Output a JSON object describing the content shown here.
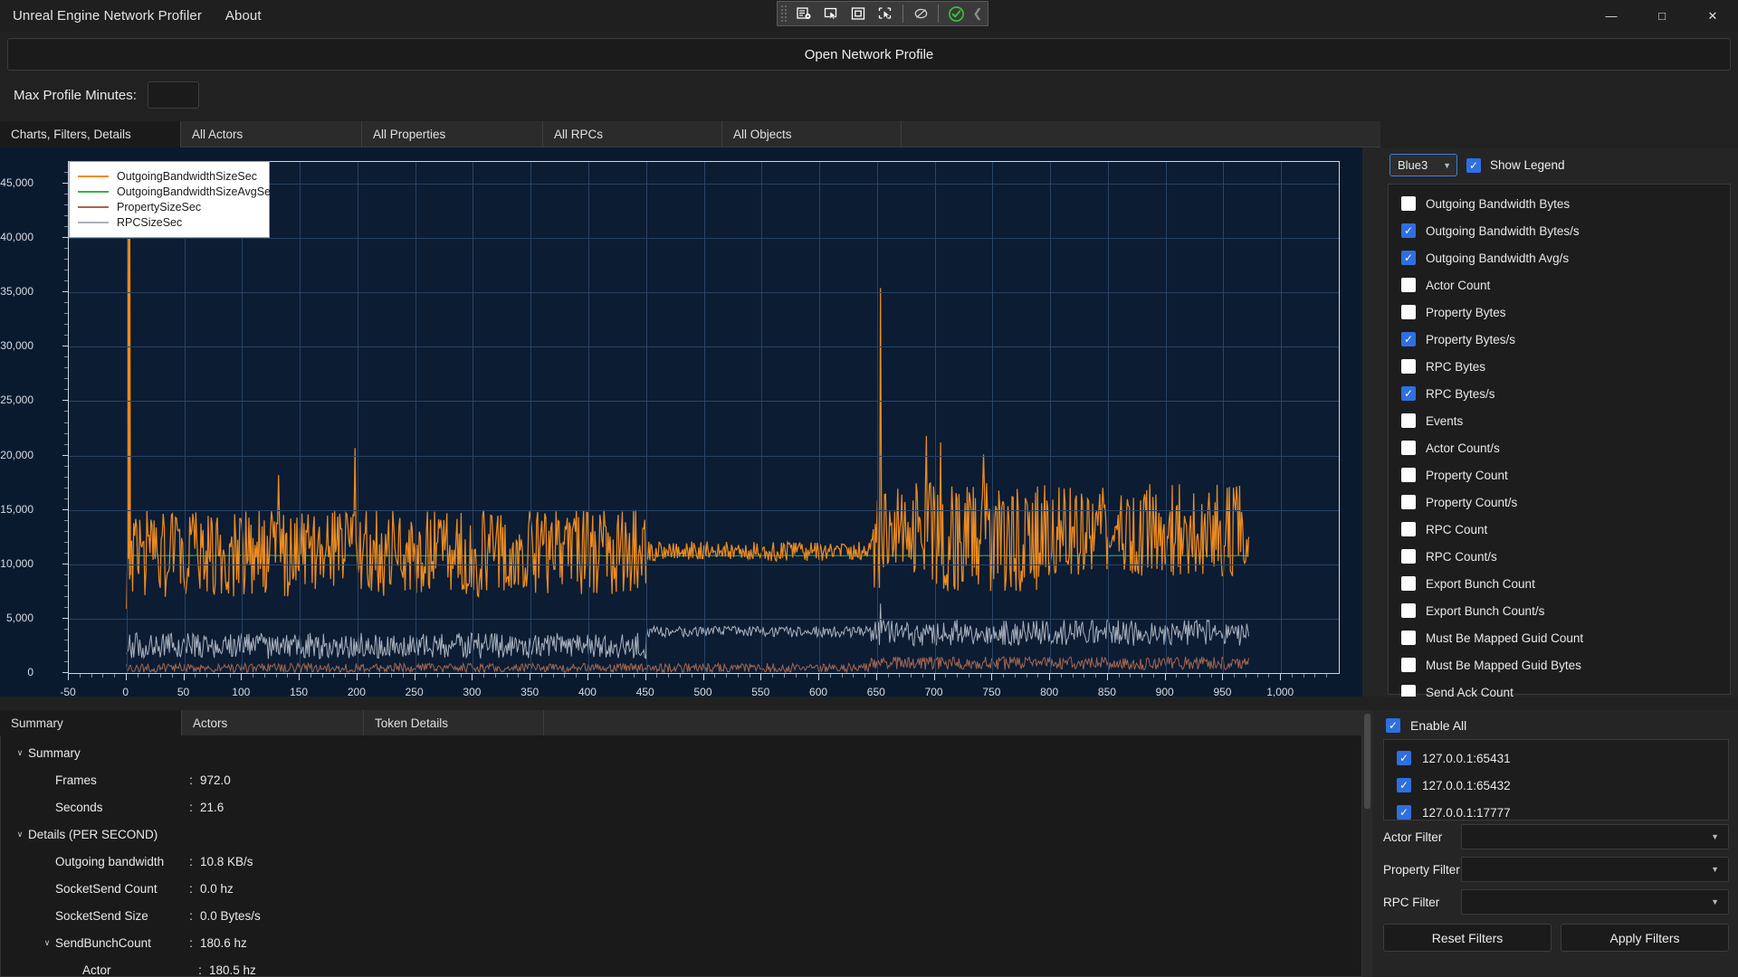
{
  "window": {
    "app_title": "Unreal Engine Network Profiler",
    "menu": [
      "Unreal Engine Network Profiler",
      "About"
    ],
    "controls": {
      "minimize": "—",
      "maximize": "□",
      "close": "✕"
    },
    "toolbar_icons": [
      "select-window-icon",
      "cursor-icon",
      "highlight-box-icon",
      "pick-element-icon",
      "disabled-icon",
      "check-circle-icon",
      "collapse-chevron-icon"
    ]
  },
  "open_profile": {
    "label": "Open Network Profile"
  },
  "max_profile": {
    "label": "Max Profile Minutes:",
    "value": "",
    "placeholder": ""
  },
  "top_tabs": [
    {
      "label": "Charts, Filters, Details",
      "active": true
    },
    {
      "label": "All Actors",
      "active": false
    },
    {
      "label": "All Properties",
      "active": false
    },
    {
      "label": "All RPCs",
      "active": false
    },
    {
      "label": "All Objects",
      "active": false
    }
  ],
  "chart_options": {
    "theme_value": "Blue3",
    "show_legend_label": "Show Legend",
    "show_legend_checked": true,
    "items": [
      {
        "label": "Outgoing Bandwidth Bytes",
        "checked": false
      },
      {
        "label": "Outgoing Bandwidth Bytes/s",
        "checked": true
      },
      {
        "label": "Outgoing Bandwidth Avg/s",
        "checked": true
      },
      {
        "label": "Actor Count",
        "checked": false
      },
      {
        "label": "Property Bytes",
        "checked": false
      },
      {
        "label": "Property Bytes/s",
        "checked": true
      },
      {
        "label": "RPC Bytes",
        "checked": false
      },
      {
        "label": "RPC Bytes/s",
        "checked": true
      },
      {
        "label": "Events",
        "checked": false
      },
      {
        "label": "Actor Count/s",
        "checked": false
      },
      {
        "label": "Property Count",
        "checked": false
      },
      {
        "label": "Property Count/s",
        "checked": false
      },
      {
        "label": "RPC Count",
        "checked": false
      },
      {
        "label": "RPC Count/s",
        "checked": false
      },
      {
        "label": "Export Bunch Count",
        "checked": false
      },
      {
        "label": "Export Bunch Count/s",
        "checked": false
      },
      {
        "label": "Must Be Mapped Guid Count",
        "checked": false
      },
      {
        "label": "Must Be Mapped Guid Bytes",
        "checked": false
      },
      {
        "label": "Send Ack Count",
        "checked": false
      }
    ]
  },
  "chart_data": {
    "type": "line",
    "title": "",
    "xlabel": "",
    "ylabel": "",
    "xlim": [
      -50,
      1050
    ],
    "ylim": [
      0,
      47000
    ],
    "xticks": [
      -50,
      0,
      50,
      100,
      150,
      200,
      250,
      300,
      350,
      400,
      450,
      500,
      550,
      600,
      650,
      700,
      750,
      800,
      850,
      900,
      950,
      1000
    ],
    "xticklabels": [
      "-50",
      "0",
      "50",
      "100",
      "150",
      "200",
      "250",
      "300",
      "350",
      "400",
      "450",
      "500",
      "550",
      "600",
      "650",
      "700",
      "750",
      "800",
      "850",
      "900",
      "950",
      "1,000"
    ],
    "yticks": [
      0,
      5000,
      10000,
      15000,
      20000,
      25000,
      30000,
      35000,
      40000,
      45000
    ],
    "yticklabels": [
      "0",
      "5,000",
      "10,000",
      "15,000",
      "20,000",
      "25,000",
      "30,000",
      "35,000",
      "40,000",
      "45,000"
    ],
    "grid": true,
    "legend_position": "top-left",
    "background": "#0b1c33",
    "series": [
      {
        "name": "OutgoingBandwidthSizeSec",
        "color": "#ED8B1F",
        "x_range": [
          0,
          972
        ],
        "baseline_mean": 11000,
        "noise_amplitude": 4200,
        "spikes": [
          {
            "x": 2,
            "y": 47000
          },
          {
            "x": 198,
            "y": 20700
          },
          {
            "x": 132,
            "y": 18200
          },
          {
            "x": 653,
            "y": 35400
          },
          {
            "x": 693,
            "y": 21800
          },
          {
            "x": 705,
            "y": 21200
          },
          {
            "x": 742,
            "y": 20100
          }
        ],
        "segment_notes": "dense ~7000-16000 band across full range; low-variance dip 455-640 around 11000; elevated variance 650-960"
      },
      {
        "name": "OutgoingBandwidthSizeAvgSec",
        "color": "#37B24D",
        "x_range": [
          0,
          972
        ],
        "baseline_mean": 10800,
        "noise_amplitude": 0,
        "spikes": [],
        "segment_notes": "green average line hidden beneath orange band"
      },
      {
        "name": "PropertySizeSec",
        "color": "#A3664E",
        "x_range": [
          0,
          972
        ],
        "baseline_mean": 620,
        "noise_amplitude": 450,
        "spikes": [],
        "segment_notes": "low brown trace just above zero"
      },
      {
        "name": "RPCSizeSec",
        "color": "#AAB2BD",
        "x_range": [
          0,
          972
        ],
        "baseline_mean": 2600,
        "noise_amplitude": 1300,
        "spikes": [
          {
            "x": 653,
            "y": 6400
          }
        ],
        "segment_notes": "grey trace around 2000-4200, slightly higher after x=450"
      }
    ]
  },
  "legend": {
    "entries": [
      {
        "label": "OutgoingBandwidthSizeSec",
        "color": "#ED8B1F"
      },
      {
        "label": "OutgoingBandwidthSizeAvgSec",
        "color": "#37B24D"
      },
      {
        "label": "PropertySizeSec",
        "color": "#A3664E"
      },
      {
        "label": "RPCSizeSec",
        "color": "#AAB2BD"
      }
    ]
  },
  "bottom_tabs": [
    {
      "label": "Summary",
      "active": true
    },
    {
      "label": "Actors",
      "active": false
    },
    {
      "label": "Token Details",
      "active": false
    }
  ],
  "summary": {
    "rows": [
      {
        "caret": "∨",
        "indent": 0,
        "key": "Summary",
        "colon": "",
        "value": ""
      },
      {
        "caret": "",
        "indent": 1,
        "key": "Frames",
        "colon": ":",
        "value": "972.0",
        "keywidth": 140
      },
      {
        "caret": "",
        "indent": 1,
        "key": "Seconds",
        "colon": ":",
        "value": "21.6",
        "keywidth": 140
      },
      {
        "caret": "∨",
        "indent": 0,
        "key": "Details (PER SECOND)",
        "colon": "",
        "value": ""
      },
      {
        "caret": "",
        "indent": 1,
        "key": "Outgoing bandwidth",
        "colon": ":",
        "value": "10.8 KB/s",
        "keywidth": 140
      },
      {
        "caret": "",
        "indent": 1,
        "key": "SocketSend Count",
        "colon": ":",
        "value": "0.0 hz",
        "keywidth": 140
      },
      {
        "caret": "",
        "indent": 1,
        "key": "SocketSend Size",
        "colon": ":",
        "value": "0.0 Bytes/s",
        "keywidth": 140
      },
      {
        "caret": "∨",
        "indent": 1,
        "key": "SendBunchCount",
        "colon": ":",
        "value": "180.6 hz",
        "keywidth": 140
      },
      {
        "caret": "",
        "indent": 2,
        "key": "Actor",
        "colon": ":",
        "value": "180.5 hz",
        "keywidth": 120
      }
    ]
  },
  "filters": {
    "enable_all_label": "Enable All",
    "enable_all_checked": true,
    "connections": [
      {
        "label": "127.0.0.1:65431",
        "checked": true
      },
      {
        "label": "127.0.0.1:65432",
        "checked": true
      },
      {
        "label": "127.0.0.1:17777",
        "checked": true
      }
    ],
    "rows": [
      {
        "label": "Actor Filter",
        "value": ""
      },
      {
        "label": "Property Filter",
        "value": ""
      },
      {
        "label": "RPC Filter",
        "value": ""
      }
    ],
    "reset_label": "Reset Filters",
    "apply_label": "Apply Filters"
  },
  "colors": {
    "accent": "#2f6fe0",
    "chart_bg": "#0b1c33",
    "grid": "#2a4363",
    "orange": "#ED8B1F",
    "green": "#37B24D",
    "brown": "#A3664E",
    "grey": "#AAB2BD"
  }
}
